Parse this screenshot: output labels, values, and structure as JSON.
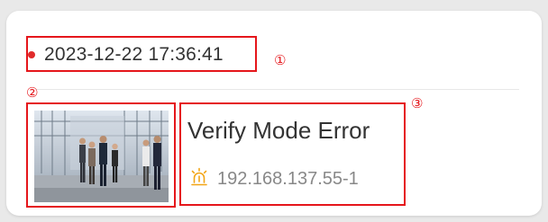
{
  "event": {
    "timestamp": "2023-12-22 17:36:41",
    "title": "Verify Mode Error",
    "device": "192.168.137.55-1",
    "status_dot_color": "#e02a2a",
    "alarm_icon": "alarm-light-icon",
    "snapshot_icon": "event-snapshot-photo"
  },
  "annotations": {
    "marker_1": "①",
    "marker_2": "②",
    "marker_3": "③",
    "color": "#e5161b"
  }
}
